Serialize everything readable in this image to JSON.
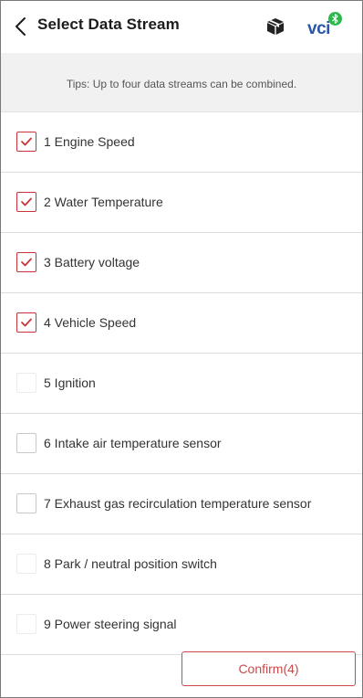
{
  "header": {
    "title": "Select Data Stream",
    "vci_label": "VCI",
    "vci_text": "vci",
    "back_icon": "chevron-left-icon",
    "box_icon": "box-icon",
    "bluetooth_icon": "bluetooth-icon"
  },
  "tips": {
    "text": "Tips: Up to four data streams can be combined."
  },
  "items": [
    {
      "label": "1 Engine Speed",
      "checked": true
    },
    {
      "label": "2 Water Temperature",
      "checked": true
    },
    {
      "label": "3 Battery voltage",
      "checked": true
    },
    {
      "label": "4 Vehicle Speed",
      "checked": true
    },
    {
      "label": "5 Ignition",
      "checked": false
    },
    {
      "label": "6 Intake air temperature sensor",
      "checked": false
    },
    {
      "label": "7 Exhaust gas recirculation temperature sensor",
      "checked": false
    },
    {
      "label": "8 Park / neutral position switch",
      "checked": false
    },
    {
      "label": "9 Power steering signal",
      "checked": false
    }
  ],
  "confirm": {
    "label": "Confirm(4)"
  },
  "colors": {
    "accent": "#c9343a",
    "vci_blue": "#2c57a8",
    "vci_green": "#2db84b",
    "tips_bg": "#f1f1f1"
  }
}
